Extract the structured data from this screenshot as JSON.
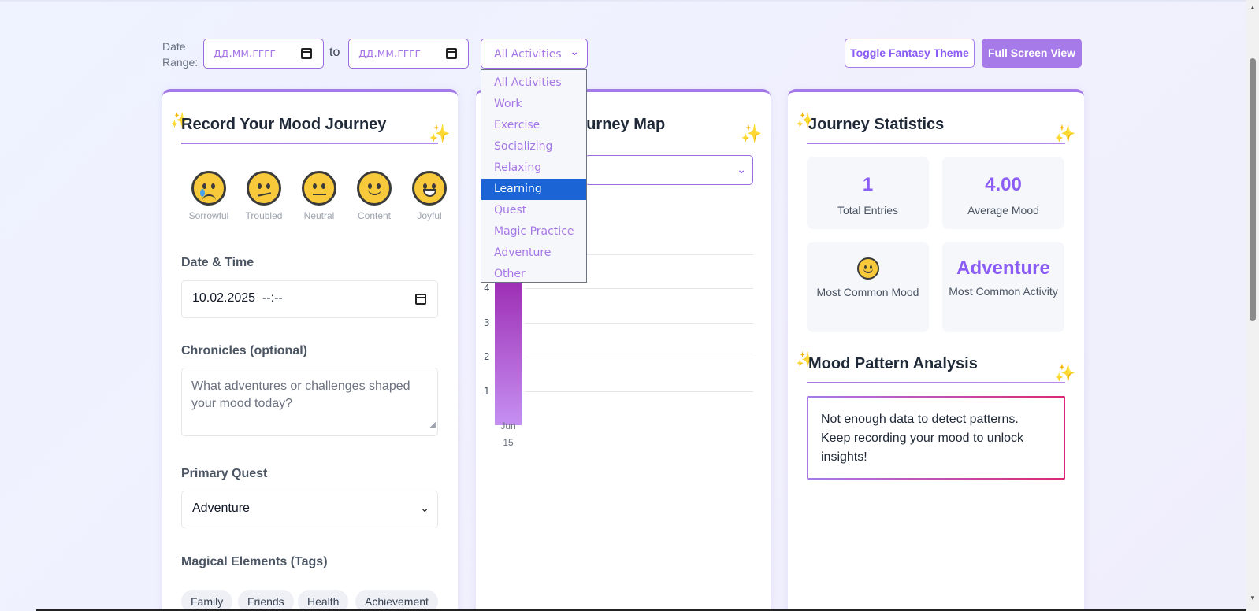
{
  "filters": {
    "date_range_label": "Date Range:",
    "date_from_placeholder": "дд.мм.гггг",
    "to_label": "to",
    "date_to_placeholder": "дд.мм.гггг",
    "activity_selected": "All Activities",
    "activity_options": [
      "All Activities",
      "Work",
      "Exercise",
      "Socializing",
      "Relaxing",
      "Learning",
      "Quest",
      "Magic Practice",
      "Adventure",
      "Other"
    ],
    "highlighted_option": "Learning",
    "toggle_theme_label": "Toggle Fantasy Theme",
    "full_screen_label": "Full Screen View"
  },
  "record": {
    "title": "Record Your Mood Journey",
    "moods": [
      {
        "label": "Sorrowful",
        "icon": "crying-face-icon"
      },
      {
        "label": "Troubled",
        "icon": "confused-face-icon"
      },
      {
        "label": "Neutral",
        "icon": "neutral-face-icon"
      },
      {
        "label": "Content",
        "icon": "slight-smile-face-icon"
      },
      {
        "label": "Joyful",
        "icon": "grinning-face-icon"
      }
    ],
    "datetime_label": "Date & Time",
    "datetime_value": "10.02.2025  --:--",
    "chronicles_label": "Chronicles (optional)",
    "chronicles_placeholder": "What adventures or challenges shaped your mood today?",
    "quest_label": "Primary Quest",
    "quest_value": "Adventure",
    "tags_label": "Magical Elements (Tags)",
    "tags": [
      "Family",
      "Friends",
      "Health",
      "Achievement"
    ]
  },
  "journey_map": {
    "title": "Mood Journey Map",
    "visible_title": "ourney Map",
    "mood_filter_value": ""
  },
  "chart_data": {
    "type": "bar",
    "categories": [
      "Jun 15"
    ],
    "x_tick_lines": [
      "Jun",
      "15"
    ],
    "values": [
      4
    ],
    "y_ticks": [
      1,
      2,
      3,
      4
    ],
    "ylim": [
      0,
      5
    ],
    "xlabel": "",
    "ylabel": "",
    "title": ""
  },
  "stats": {
    "title": "Journey Statistics",
    "total_entries_value": "1",
    "total_entries_label": "Total Entries",
    "average_mood_value": "4.00",
    "average_mood_label": "Average Mood",
    "common_mood_icon": "slight-smile-face-icon",
    "common_mood_label": "Most Common Mood",
    "common_activity_value": "Adventure",
    "common_activity_label": "Most Common Activity"
  },
  "patterns": {
    "title": "Mood Pattern Analysis",
    "message": "Not enough data to detect patterns. Keep recording your mood to unlock insights!"
  },
  "colors": {
    "accent": "#a67ae9",
    "accent_dark": "#8b5cf6",
    "dropdown_highlight": "#1a64d6",
    "bar_top": "#9b27b0",
    "bar_bottom": "#c590f2"
  }
}
